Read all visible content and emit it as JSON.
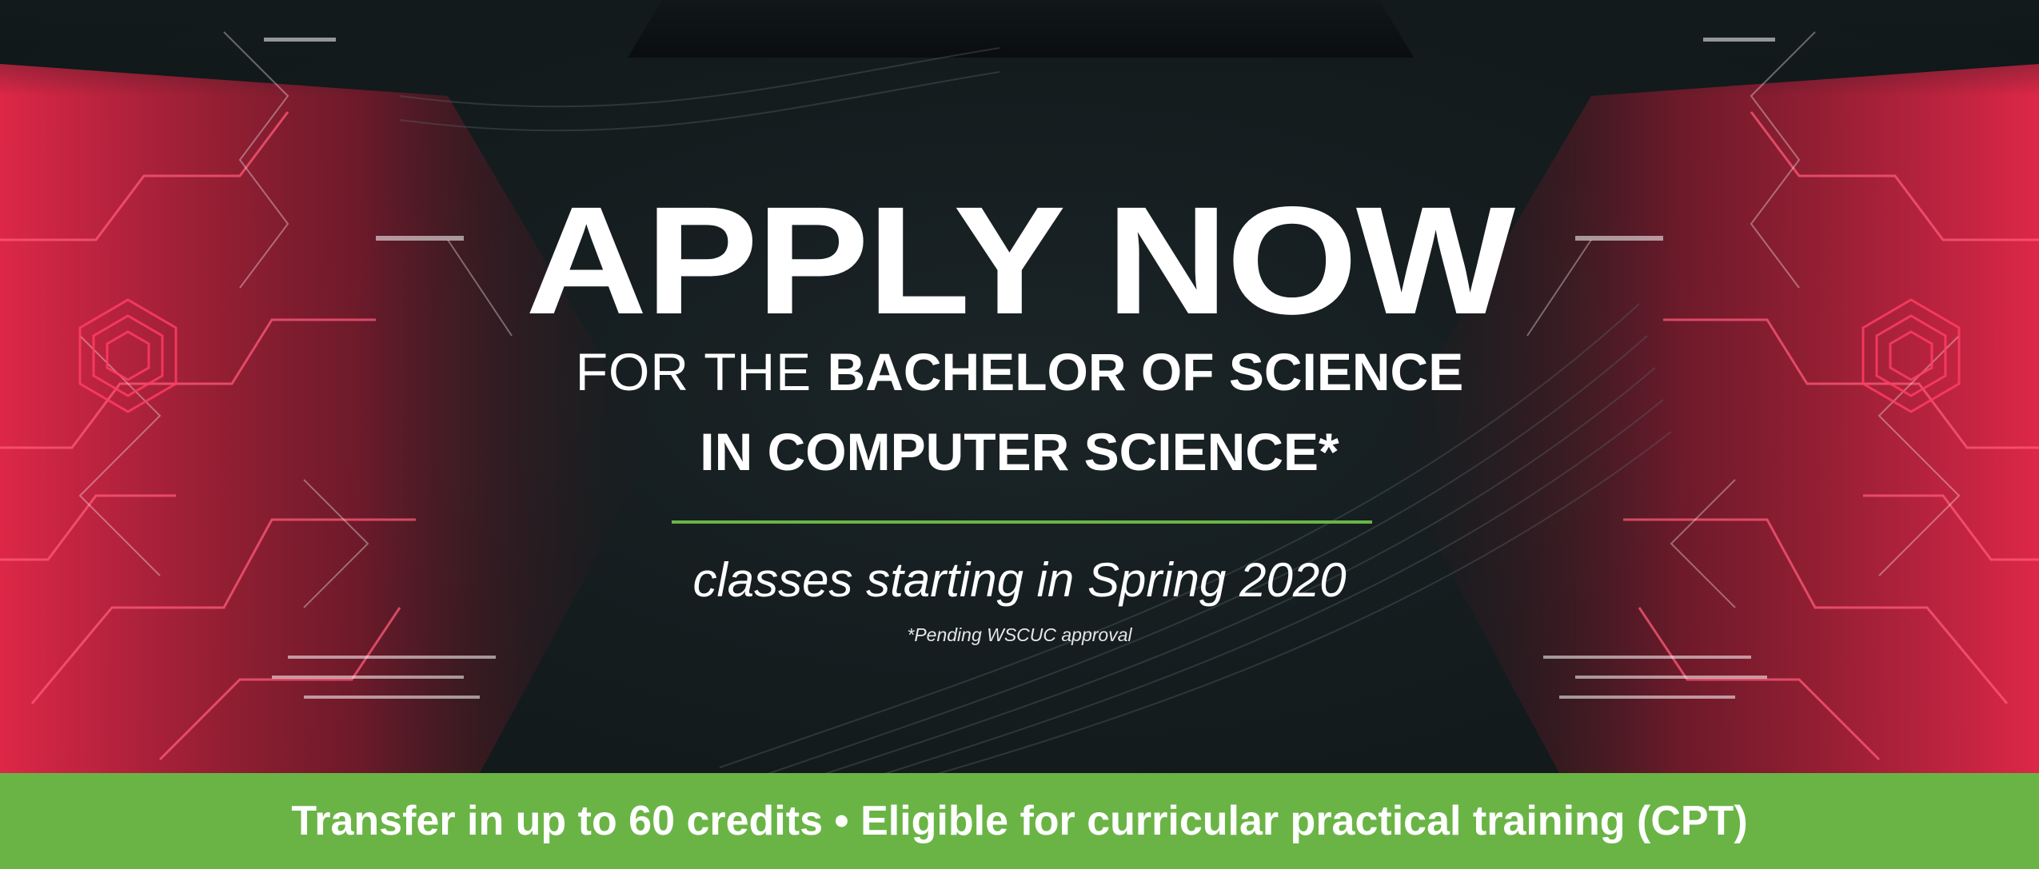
{
  "banner": {
    "headline": "APPLY NOW",
    "program_prefix": "FOR THE ",
    "program_name_line1": "BACHELOR OF SCIENCE",
    "program_name_line2": "IN COMPUTER SCIENCE*",
    "tagline": "classes starting in Spring 2020",
    "footnote": "*Pending WSCUC approval"
  },
  "bottom_bar": {
    "text": "Transfer in up to 60 credits • Eligible for curricular practical training (CPT)"
  },
  "colors": {
    "background": "#121a1c",
    "accent_green": "#6ab446",
    "art_red": "#e8284a",
    "headline_text": "#ffffff"
  }
}
